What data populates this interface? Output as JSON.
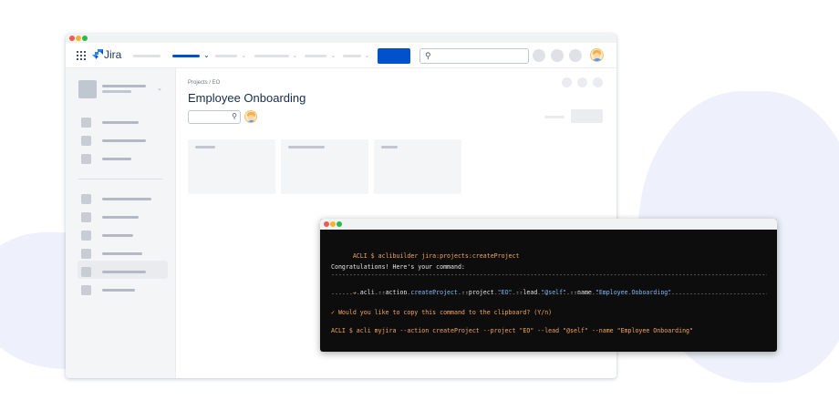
{
  "topnav": {
    "product_name": "Jira",
    "search_icon": "search-icon",
    "apps_icon": "app-switcher-icon"
  },
  "main": {
    "breadcrumb": "Projects / EO",
    "page_title": "Employee Onboarding"
  },
  "terminal": {
    "line1_prompt": "ACLI $ ",
    "line1_cmd": "aclibuilder jira:projects:createProject",
    "line2": "Congratulations! Here's your command:",
    "dashes": "----------------------------------------------------------------------------------------------------------------------------------",
    "line3_arrow": "→ ",
    "line3_a": "acli --action ",
    "line3_action": "createProject",
    "line3_b": " --project ",
    "line3_project": "\"EO\"",
    "line3_c": " --lead ",
    "line3_lead": "\"@self\"",
    "line3_d": " --name ",
    "line3_name": "\"Employee Onboarding\"",
    "line4": "✓ Would you like to copy this command to the clipboard? (Y/n)",
    "line5": "ACLI $ acli myjira --action createProject --project \"EO\" --lead \"@self\" --name \"Employee Onboarding\""
  },
  "colors": {
    "accent": "#0052cc",
    "terminal_bg": "#0d0d0d",
    "terminal_orange": "#f5a65b",
    "terminal_blue": "#79b8ff"
  }
}
